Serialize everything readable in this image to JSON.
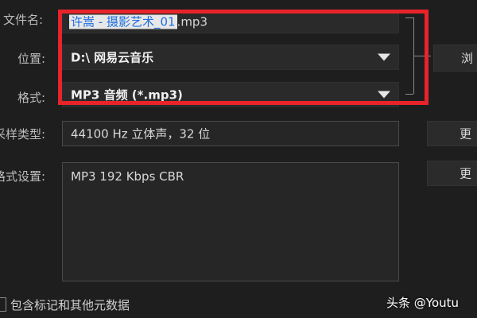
{
  "labels": {
    "filename": "文件名:",
    "location": "位置:",
    "format": "格式:",
    "sample_type": "采样类型:",
    "format_settings": "格式设置:"
  },
  "filename": {
    "selected": "许嵩 - 摄影艺术_01",
    "rest": ".mp3"
  },
  "location": {
    "value": "D:\\ 网易云音乐"
  },
  "format": {
    "value": "MP3 音频 (*.mp3)"
  },
  "sample_type": {
    "value": "44100 Hz 立体声，32 位"
  },
  "format_settings": {
    "value": "MP3 192 Kbps CBR"
  },
  "buttons": {
    "browse": "浏",
    "change_sample": "更",
    "change_format": "更"
  },
  "metadata_checkbox": {
    "label": "包含标记和其他元数据"
  },
  "watermark": "头条 @Youtu",
  "colors": {
    "highlight": "#e8232a",
    "background": "#1e1e1e"
  }
}
